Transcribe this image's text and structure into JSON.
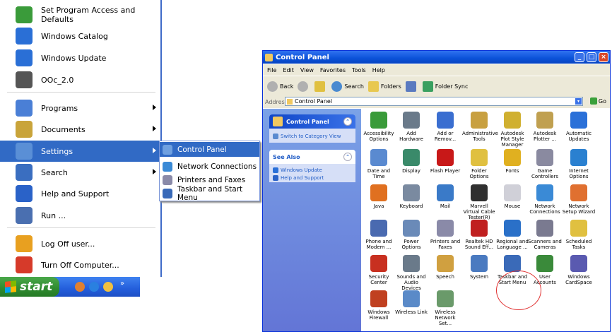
{
  "start_menu": {
    "items": [
      {
        "label": "Set Program Access and Defaults",
        "icon": "program-access-icon",
        "color": "#3a9b3a",
        "has_arrow": false
      },
      {
        "label": "Windows Catalog",
        "icon": "windows-catalog-icon",
        "color": "#2a6fd6",
        "has_arrow": false
      },
      {
        "label": "Windows Update",
        "icon": "windows-update-icon",
        "color": "#2a6fd6",
        "has_arrow": false
      },
      {
        "label": "OOc_2.0",
        "icon": "ooc-icon",
        "color": "#555555",
        "has_arrow": false
      },
      {
        "label": "Programs",
        "icon": "programs-icon",
        "color": "#4a7fd6",
        "has_arrow": true
      },
      {
        "label": "Documents",
        "icon": "documents-icon",
        "color": "#c9a43a",
        "has_arrow": true
      },
      {
        "label": "Settings",
        "icon": "settings-icon",
        "color": "#5a8fd6",
        "has_arrow": true,
        "highlighted": true
      },
      {
        "label": "Search",
        "icon": "search-icon",
        "color": "#3a6ec0",
        "has_arrow": true
      },
      {
        "label": "Help and Support",
        "icon": "help-icon",
        "color": "#2a62c8",
        "has_arrow": false
      },
      {
        "label": "Run ...",
        "icon": "run-icon",
        "color": "#4a6fb0",
        "has_arrow": false
      },
      {
        "label": "Log Off user...",
        "icon": "log-off-icon",
        "color": "#e8a020",
        "has_arrow": false
      },
      {
        "label": "Turn Off Computer...",
        "icon": "turn-off-icon",
        "color": "#d63a2a",
        "has_arrow": false
      }
    ]
  },
  "settings_submenu": {
    "items": [
      {
        "label": "Control Panel",
        "highlighted": true,
        "color": "#6fa0e0"
      },
      {
        "label": "Network Connections",
        "highlighted": false,
        "color": "#3a8ad6"
      },
      {
        "label": "Printers and Faxes",
        "highlighted": false,
        "color": "#8a8aa8"
      },
      {
        "label": "Taskbar and Start Menu",
        "highlighted": false,
        "color": "#3a6ab8"
      }
    ]
  },
  "taskbar": {
    "start_label": "start"
  },
  "control_panel": {
    "title": "Control Panel",
    "menu": [
      "File",
      "Edit",
      "View",
      "Favorites",
      "Tools",
      "Help"
    ],
    "toolbar": {
      "back": "Back",
      "search": "Search",
      "folders": "Folders",
      "folder_sync": "Folder Sync"
    },
    "address": {
      "label": "Address",
      "value": "Control Panel",
      "go": "Go"
    },
    "left_pane": {
      "header_title": "Control Panel",
      "switch_link": "Switch to Category View",
      "see_also_title": "See Also",
      "see_also_links": [
        "Windows Update",
        "Help and Support"
      ]
    },
    "icons": [
      {
        "label": "Accessibility Options",
        "icon": "accessibility-icon",
        "color": "#3a9b3a"
      },
      {
        "label": "Add Hardware",
        "icon": "add-hardware-icon",
        "color": "#6a7a8a"
      },
      {
        "label": "Add or Remov...",
        "icon": "add-remove-icon",
        "color": "#3a6ed0"
      },
      {
        "label": "Administrative Tools",
        "icon": "admin-tools-icon",
        "color": "#c8a040"
      },
      {
        "label": "Autodesk Plot Style Manager",
        "icon": "autodesk-plot-icon",
        "color": "#d0b030"
      },
      {
        "label": "Autodesk Plotter ...",
        "icon": "autodesk-plotter-icon",
        "color": "#c0a050"
      },
      {
        "label": "Automatic Updates",
        "icon": "automatic-updates-icon",
        "color": "#2a70d8"
      },
      {
        "label": "Date and Time",
        "icon": "date-time-icon",
        "color": "#5a8ad0"
      },
      {
        "label": "Display",
        "icon": "display-icon",
        "color": "#3a8a6a"
      },
      {
        "label": "Flash Player",
        "icon": "flash-player-icon",
        "color": "#c81818"
      },
      {
        "label": "Folder Options",
        "icon": "folder-options-icon",
        "color": "#e0c040"
      },
      {
        "label": "Fonts",
        "icon": "fonts-icon",
        "color": "#e0b020"
      },
      {
        "label": "Game Controllers",
        "icon": "game-controllers-icon",
        "color": "#8a8aa0"
      },
      {
        "label": "Internet Options",
        "icon": "internet-options-icon",
        "color": "#2a80d0"
      },
      {
        "label": "Java",
        "icon": "java-icon",
        "color": "#e07020"
      },
      {
        "label": "Keyboard",
        "icon": "keyboard-icon",
        "color": "#7a8aa0"
      },
      {
        "label": "Mail",
        "icon": "mail-icon",
        "color": "#3a7ac8"
      },
      {
        "label": "Marvell Virtual Cable Tester(R)",
        "icon": "cable-tester-icon",
        "color": "#303030"
      },
      {
        "label": "Mouse",
        "icon": "mouse-icon",
        "color": "#d0d0d8"
      },
      {
        "label": "Network Connections",
        "icon": "network-connections-icon",
        "color": "#3a8ad6"
      },
      {
        "label": "Network Setup Wizard",
        "icon": "network-setup-icon",
        "color": "#e07030"
      },
      {
        "label": "Phone and Modem ...",
        "icon": "phone-modem-icon",
        "color": "#4a6ab0"
      },
      {
        "label": "Power Options",
        "icon": "power-options-icon",
        "color": "#6a8ab8"
      },
      {
        "label": "Printers and Faxes",
        "icon": "printers-icon",
        "color": "#8a8aa8"
      },
      {
        "label": "Realtek HD Sound Eff...",
        "icon": "realtek-sound-icon",
        "color": "#c02020"
      },
      {
        "label": "Regional and Language ...",
        "icon": "regional-language-icon",
        "color": "#2a70c8"
      },
      {
        "label": "Scanners and Cameras",
        "icon": "scanners-icon",
        "color": "#7a7a90"
      },
      {
        "label": "Scheduled Tasks",
        "icon": "scheduled-tasks-icon",
        "color": "#e0c040"
      },
      {
        "label": "Security Center",
        "icon": "security-center-icon",
        "color": "#c83020"
      },
      {
        "label": "Sounds and Audio Devices",
        "icon": "sounds-icon",
        "color": "#6a7a8a"
      },
      {
        "label": "Speech",
        "icon": "speech-icon",
        "color": "#d0a040"
      },
      {
        "label": "System",
        "icon": "system-icon",
        "color": "#4a7ac0"
      },
      {
        "label": "Taskbar and Start Menu",
        "icon": "taskbar-icon",
        "color": "#3a6ab8"
      },
      {
        "label": "User Accounts",
        "icon": "user-accounts-icon",
        "color": "#3a8a3a"
      },
      {
        "label": "Windows CardSpace",
        "icon": "cardspace-icon",
        "color": "#5a5ab0"
      },
      {
        "label": "Windows Firewall",
        "icon": "firewall-icon",
        "color": "#c04020"
      },
      {
        "label": "Wireless Link",
        "icon": "wireless-link-icon",
        "color": "#5a8ac8"
      },
      {
        "label": "Wireless Network Set...",
        "icon": "wireless-network-icon",
        "color": "#6a9a6a"
      }
    ],
    "annotation_color": "#e03030"
  },
  "colors": {
    "highlight": "#316ac5",
    "title_bar": "#0a51d8",
    "start_button": "#2f8a2f"
  }
}
